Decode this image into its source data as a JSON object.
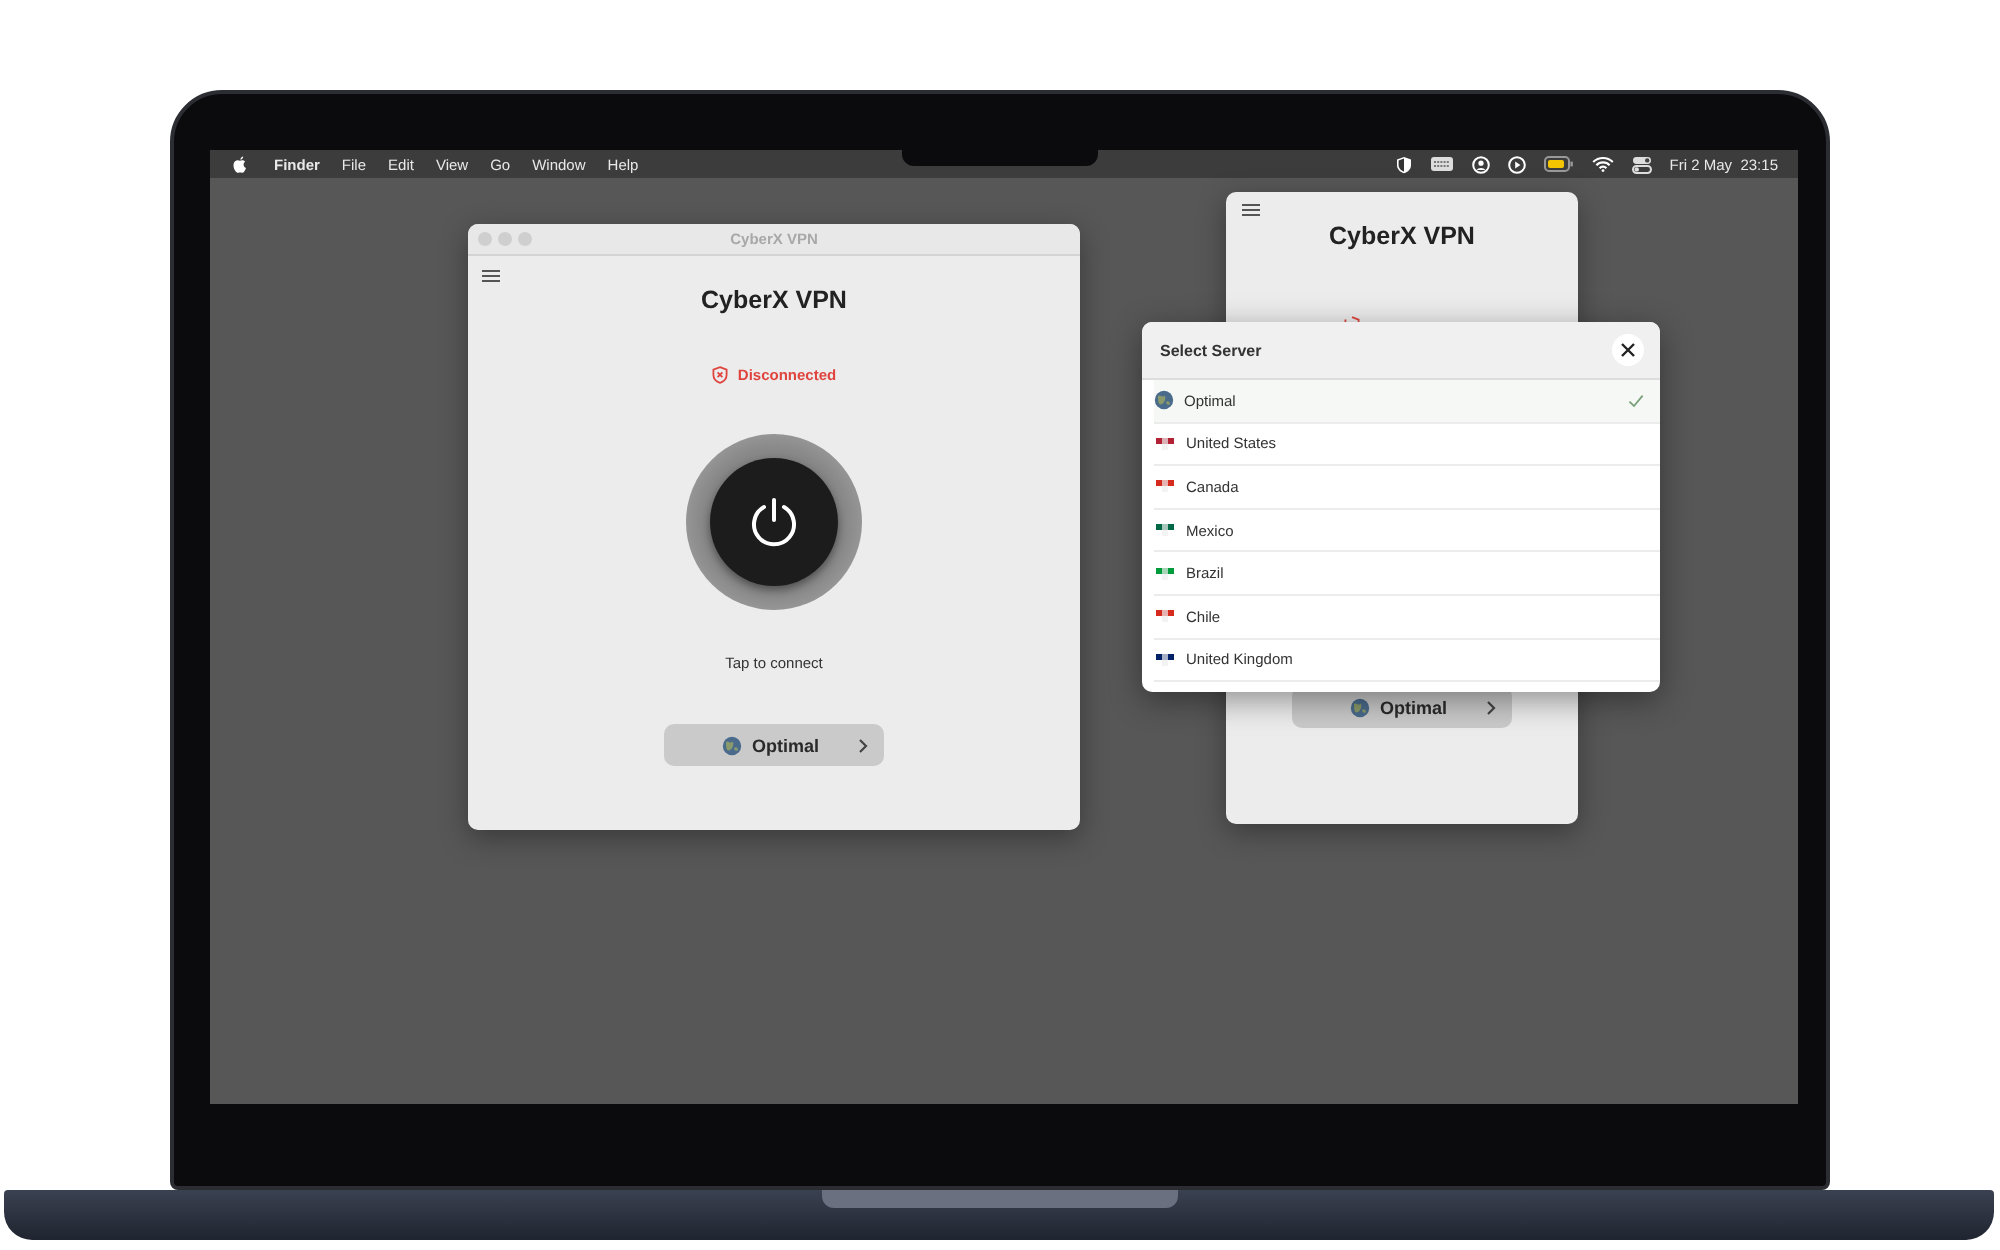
{
  "menu_bar": {
    "items": [
      {
        "label": "Finder",
        "kind": "app"
      },
      {
        "label": "File",
        "kind": "menu"
      },
      {
        "label": "Edit",
        "kind": "menu"
      },
      {
        "label": "View",
        "kind": "menu"
      },
      {
        "label": "Go",
        "kind": "menu"
      },
      {
        "label": "Window",
        "kind": "menu"
      },
      {
        "label": "Help",
        "kind": "menu"
      }
    ],
    "clock": "Fri 2 May  23:15"
  },
  "main_window": {
    "title": "CyberX VPN",
    "app_title": "CyberX VPN",
    "status": "Disconnected",
    "hint": "Tap to connect",
    "server_button": "Optimal"
  },
  "popover": {
    "app_title": "CyberX VPN",
    "server_button": "Optimal"
  },
  "server_sheet": {
    "title": "Select Server",
    "servers": [
      {
        "name": "Optimal",
        "kind": "globe",
        "selected": true
      },
      {
        "name": "United States",
        "kind": "flag",
        "color": "#b22234",
        "selected": false
      },
      {
        "name": "Canada",
        "kind": "flag",
        "color": "#d52b1e",
        "selected": false
      },
      {
        "name": "Mexico",
        "kind": "flag",
        "color": "#006847",
        "selected": false
      },
      {
        "name": "Brazil",
        "kind": "flag",
        "color": "#009c3b",
        "selected": false
      },
      {
        "name": "Chile",
        "kind": "flag",
        "color": "#d52b1e",
        "selected": false
      },
      {
        "name": "United Kingdom",
        "kind": "flag",
        "color": "#012169",
        "selected": false
      }
    ]
  }
}
